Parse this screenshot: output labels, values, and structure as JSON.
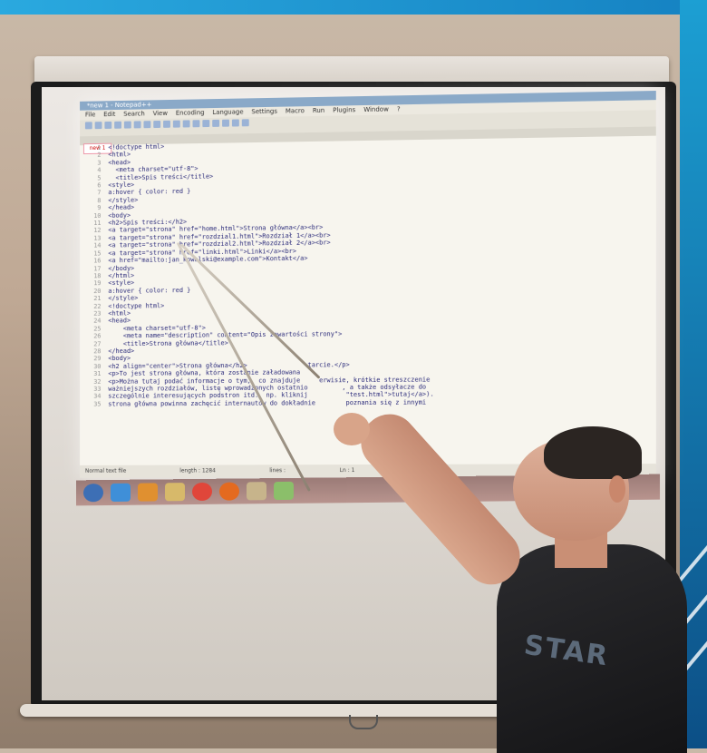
{
  "editor": {
    "title": "*new 1 - Notepad++",
    "menu": [
      "File",
      "Edit",
      "Search",
      "View",
      "Encoding",
      "Language",
      "Settings",
      "Macro",
      "Run",
      "Plugins",
      "Window",
      "?"
    ],
    "tab": "new 1",
    "code_lines": [
      {
        "n": "1",
        "t": "<!doctype html>"
      },
      {
        "n": "2",
        "t": "<html>"
      },
      {
        "n": "3",
        "t": "<head>"
      },
      {
        "n": "4",
        "t": "  <meta charset=\"utf-8\">"
      },
      {
        "n": "5",
        "t": "  <title>Spis treści</title>"
      },
      {
        "n": "6",
        "t": "<style>"
      },
      {
        "n": "7",
        "t": "a:hover { color: red }"
      },
      {
        "n": "8",
        "t": "</style>"
      },
      {
        "n": "9",
        "t": "</head>"
      },
      {
        "n": "10",
        "t": "<body>"
      },
      {
        "n": "11",
        "t": "<h2>Spis treści:</h2>"
      },
      {
        "n": "12",
        "t": "<a target=\"strona\" href=\"home.html\">Strona główna</a><br>"
      },
      {
        "n": "13",
        "t": "<a target=\"strona\" href=\"rozdzial1.html\">Rozdział 1</a><br>"
      },
      {
        "n": "14",
        "t": "<a target=\"strona\" href=\"rozdzial2.html\">Rozdział 2</a><br>"
      },
      {
        "n": "15",
        "t": "<a target=\"strona\" href=\"linki.html\">Linki</a><br>"
      },
      {
        "n": "16",
        "t": "<a href=\"mailto:jan_kowalski@example.com\">Kontakt</a>"
      },
      {
        "n": "17",
        "t": "</body>"
      },
      {
        "n": "18",
        "t": "</html>"
      },
      {
        "n": "19",
        "t": "<style>"
      },
      {
        "n": "20",
        "t": "a:hover { color: red }"
      },
      {
        "n": "21",
        "t": "</style>"
      },
      {
        "n": "22",
        "t": "<!doctype html>"
      },
      {
        "n": "23",
        "t": "<html>"
      },
      {
        "n": "24",
        "t": "<head>"
      },
      {
        "n": "25",
        "t": "    <meta charset=\"utf-8\">"
      },
      {
        "n": "26",
        "t": "    <meta name=\"description\" content=\"Opis zawartości strony\">"
      },
      {
        "n": "27",
        "t": "    <title>Strona główna</title>"
      },
      {
        "n": "28",
        "t": "</head>"
      },
      {
        "n": "29",
        "t": "<body>"
      },
      {
        "n": "30",
        "t": "<h2 align=\"center\">Strona główna</h2>                tarcie.</p>"
      },
      {
        "n": "31",
        "t": "<p>To jest strona główna, która zostanie załadowana"
      },
      {
        "n": "32",
        "t": "<p>Można tutaj podać informacje o tym,  co znajduje     erwisie, krótkie streszczenie"
      },
      {
        "n": "33",
        "t": "ważniejszych rozdziałów, listę wprowadzonych ostatnio         , a także odsyłacze do"
      },
      {
        "n": "34",
        "t": "szczególnie interesujących podstron itd.  np. kliknij          \"test.html\">tutaj</a>)."
      },
      {
        "n": "35",
        "t": "strona główna powinna zachęcić internautów do dokładnie        poznania się z innymi"
      }
    ],
    "status": {
      "type": "Normal text file",
      "length": "length : 1284",
      "lines": "lines :",
      "ln": "Ln : 1"
    }
  },
  "shirt_text": "STAR",
  "colors": {
    "screen": "#e6e1db",
    "frame": "#1b1b1b",
    "code_text": "#2a2a7a",
    "shirt": "#1d1d20",
    "accent_blue": "#1582c2"
  },
  "taskbar_icons": [
    "start-orb-icon",
    "ie-icon",
    "media-player-icon",
    "folder-icon",
    "chrome-icon",
    "firefox-icon",
    "explorer-icon",
    "notepad-icon"
  ]
}
